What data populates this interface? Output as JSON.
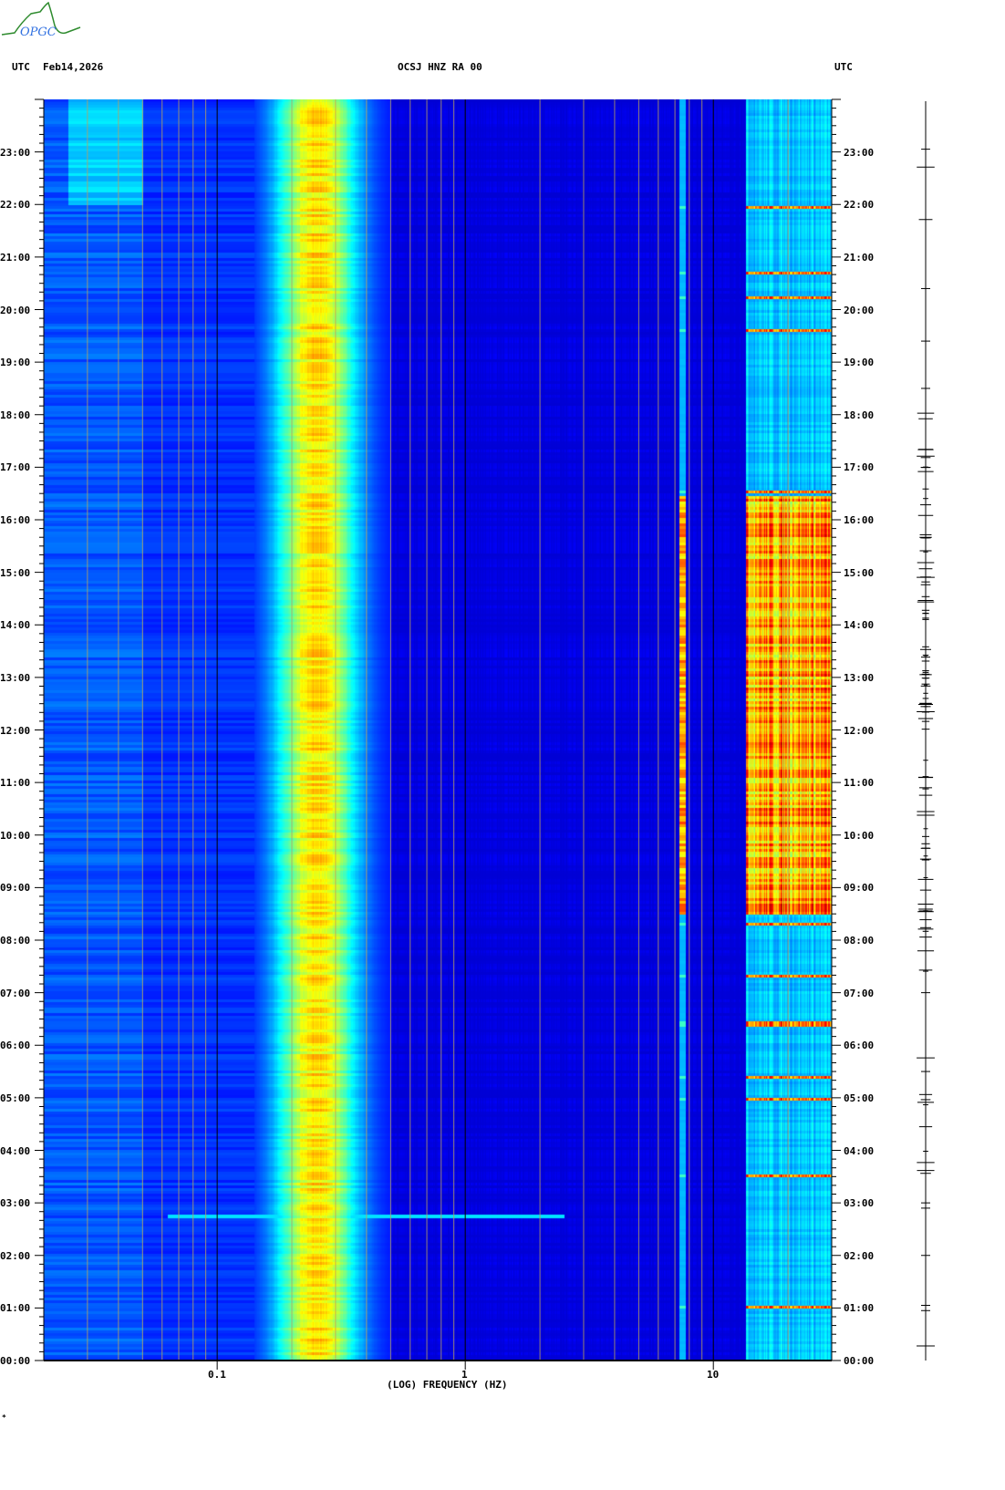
{
  "header": {
    "logo_text": "OPGC",
    "left_label": "UTC",
    "date": "Feb14,2026",
    "station": "OCSJ HNZ RA 00",
    "right_label": "UTC"
  },
  "footer_mark": "*",
  "chart_data": {
    "type": "heatmap",
    "title": "OCSJ HNZ RA 00",
    "xlabel": "(LOG) FREQUENCY (HZ)",
    "x_scale": "log",
    "xlim": [
      0.02,
      30
    ],
    "x_ticks": [
      {
        "value": 0.1,
        "label": "0.1"
      },
      {
        "value": 1,
        "label": "1"
      },
      {
        "value": 10,
        "label": "10"
      }
    ],
    "ylabel": "UTC",
    "ylim_hours": [
      0,
      24
    ],
    "y_ticks": [
      "00:00",
      "01:00",
      "02:00",
      "03:00",
      "04:00",
      "05:00",
      "06:00",
      "07:00",
      "08:00",
      "09:00",
      "10:00",
      "11:00",
      "12:00",
      "13:00",
      "14:00",
      "15:00",
      "16:00",
      "17:00",
      "18:00",
      "19:00",
      "20:00",
      "21:00",
      "22:00",
      "23:00"
    ],
    "features": {
      "microseism_peak_hz": 0.25,
      "spectral_line_hz": 7.5,
      "high_freq_activity_hours": [
        8.5,
        16.5
      ],
      "transient_event_hour": 2.75
    },
    "colormap": [
      "#00007f",
      "#0000ff",
      "#00ffff",
      "#ffff00",
      "#ff0000",
      "#7f0000"
    ]
  }
}
